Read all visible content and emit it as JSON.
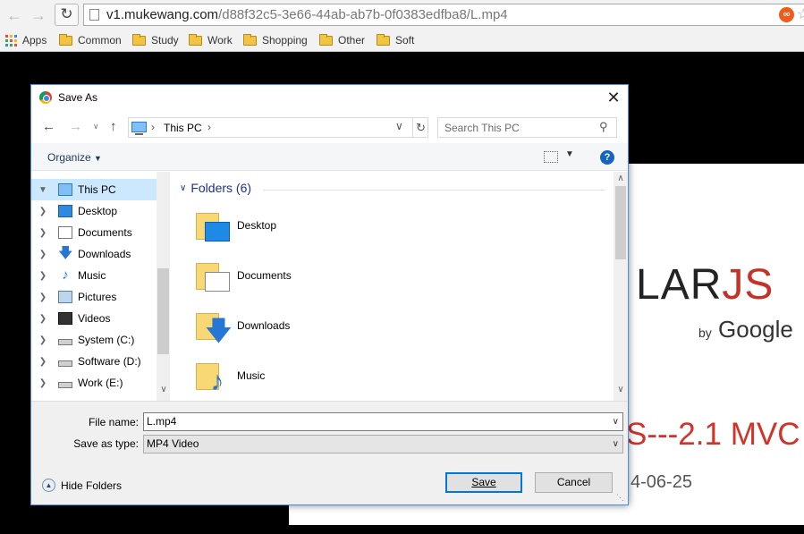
{
  "browser": {
    "url_host": "v1.mukewang.com",
    "url_path": "/d88f32c5-3e66-44ab-ab7b-0f0383edfba8/L.mp4",
    "reload_icon": "reload-icon",
    "back_icon": "back-icon",
    "forward_icon": "forward-icon",
    "extension_icon": "infinity-extension-icon",
    "extension_glyph": "∞",
    "extension_color": "#f05a1a"
  },
  "bookmarks": {
    "apps_label": "Apps",
    "items": [
      {
        "label": "Common"
      },
      {
        "label": "Study"
      },
      {
        "label": "Work"
      },
      {
        "label": "Shopping"
      },
      {
        "label": "Other"
      },
      {
        "label": "Soft"
      }
    ]
  },
  "page": {
    "logo_dark": "LAR",
    "logo_red": "JS",
    "by": "by",
    "google": "Google",
    "mvc_heading": "S---2.1 MVC",
    "date_text": "4-06-25"
  },
  "dialog": {
    "title": "Save As",
    "close_glyph": "✕",
    "breadcrumb": "This PC",
    "search_placeholder": "Search This PC",
    "organize_label": "Organize",
    "help_glyph": "?",
    "nav_tree": [
      {
        "label": "This PC",
        "icon": "pc-icon",
        "selected": true
      },
      {
        "label": "Desktop",
        "icon": "desktop-icon"
      },
      {
        "label": "Documents",
        "icon": "documents-icon"
      },
      {
        "label": "Downloads",
        "icon": "downloads-icon"
      },
      {
        "label": "Music",
        "icon": "music-icon"
      },
      {
        "label": "Pictures",
        "icon": "pictures-icon"
      },
      {
        "label": "Videos",
        "icon": "videos-icon"
      },
      {
        "label": "System (C:)",
        "icon": "system-drive-icon"
      },
      {
        "label": "Software (D:)",
        "icon": "drive-icon"
      },
      {
        "label": "Work (E:)",
        "icon": "drive-icon"
      }
    ],
    "group_label": "Folders (6)",
    "folders": [
      {
        "label": "Desktop",
        "icon": "desktop-folder-icon"
      },
      {
        "label": "Documents",
        "icon": "documents-folder-icon"
      },
      {
        "label": "Downloads",
        "icon": "downloads-folder-icon"
      },
      {
        "label": "Music",
        "icon": "music-folder-icon"
      }
    ],
    "file_name_label": "File name:",
    "file_name_value": "L.mp4",
    "save_type_label": "Save as type:",
    "save_type_value": "MP4 Video",
    "hide_folders_label": "Hide Folders",
    "save_button": "Save",
    "cancel_button": "Cancel",
    "accent_color": "#0078d7"
  }
}
